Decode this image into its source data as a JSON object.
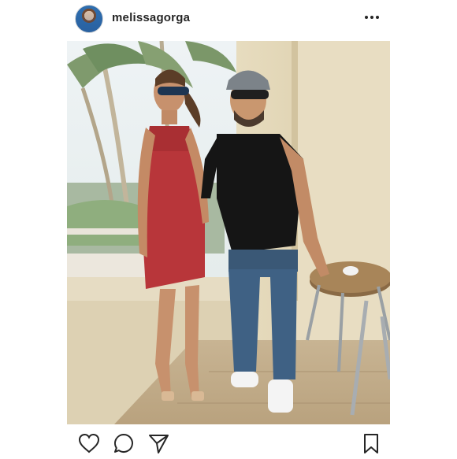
{
  "post": {
    "username": "melissagorga"
  },
  "icons": {
    "more": "more-options-icon",
    "like": "heart-icon",
    "comment": "comment-icon",
    "share": "share-icon",
    "save": "bookmark-icon"
  },
  "photo": {
    "description_hidden": ""
  }
}
